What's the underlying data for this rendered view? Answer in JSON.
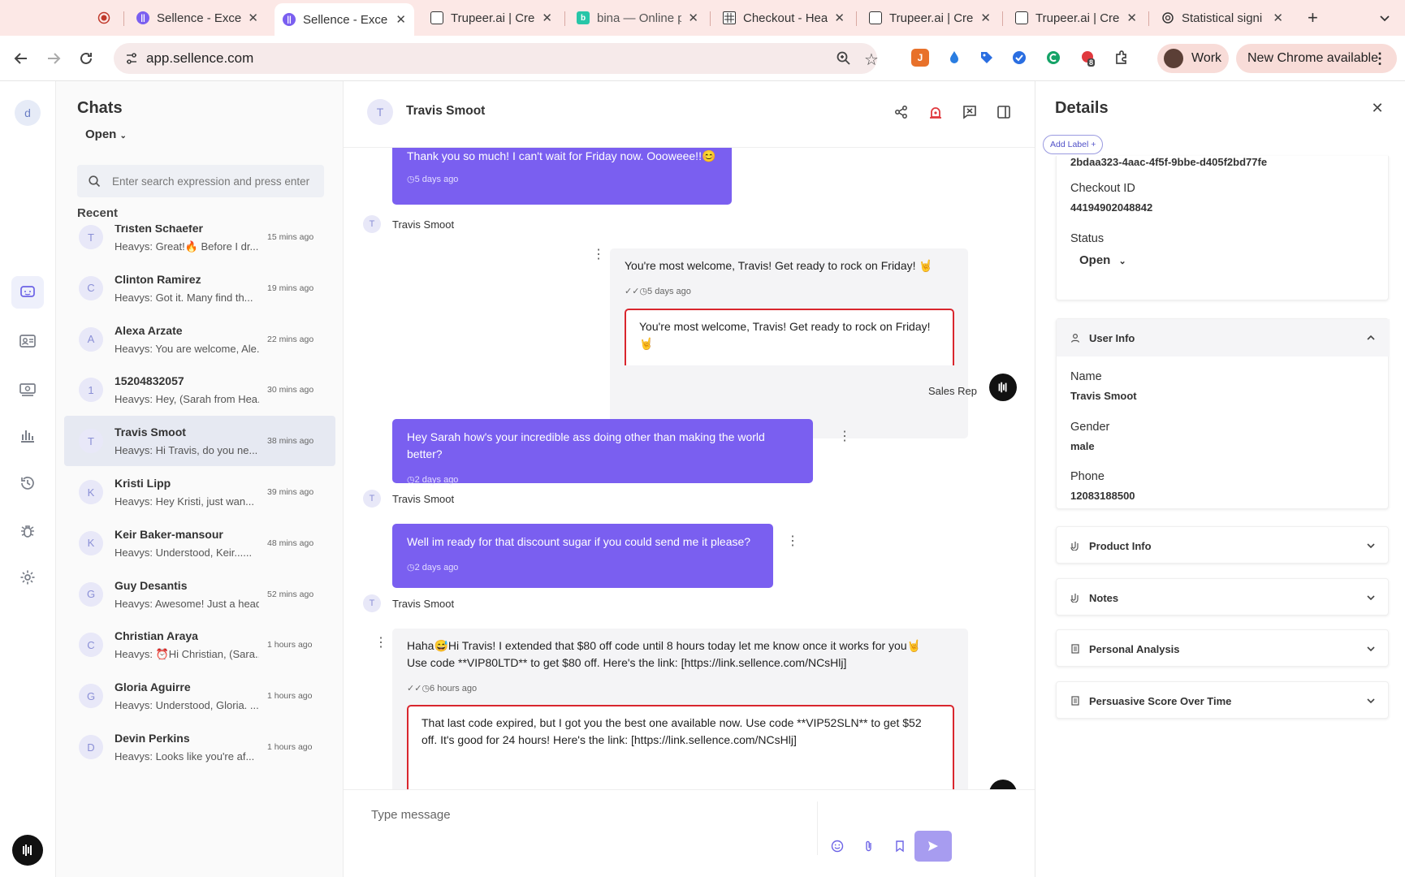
{
  "browser": {
    "tabs": [
      {
        "title": "",
        "icon": "record-icon"
      },
      {
        "title": "Sellence - Exce",
        "icon": "sellence-icon"
      },
      {
        "title": "Sellence - Exce",
        "icon": "sellence-icon",
        "active": true
      },
      {
        "title": "Trupeer.ai | Cre",
        "icon": "trupeer-icon"
      },
      {
        "title": "bina — Online p",
        "icon": "bina-icon"
      },
      {
        "title": "Checkout - Hea",
        "icon": "sheet-icon"
      },
      {
        "title": "Trupeer.ai | Cre",
        "icon": "trupeer-icon"
      },
      {
        "title": "Trupeer.ai | Cre",
        "icon": "trupeer-icon"
      },
      {
        "title": "Statistical signi",
        "icon": "openai-icon"
      }
    ],
    "url": "app.sellence.com",
    "profile": "Work",
    "update_label": "New Chrome available",
    "extension_badge": "8"
  },
  "rail": {
    "workspace_initial": "d"
  },
  "chats": {
    "title": "Chats",
    "filter": "Open",
    "search_placeholder": "Enter search expression and press enter",
    "recent_label": "Recent",
    "items": [
      {
        "initial": "T",
        "name": "Tristen Schaefer",
        "preview": "Heavys: Great!🔥 Before I dr...",
        "time": "15 mins ago"
      },
      {
        "initial": "C",
        "name": "Clinton Ramirez",
        "preview": "Heavys: Got it. Many find th...",
        "time": "19 mins ago"
      },
      {
        "initial": "A",
        "name": "Alexa Arzate",
        "preview": "Heavys: You are welcome, Ale...",
        "time": "22 mins ago"
      },
      {
        "initial": "1",
        "name": "15204832057",
        "preview": "Heavys: Hey, (Sarah from Hea...",
        "time": "30 mins ago"
      },
      {
        "initial": "T",
        "name": "Travis Smoot",
        "preview": "Heavys: Hi Travis, do you ne...",
        "time": "38 mins ago",
        "active": true
      },
      {
        "initial": "K",
        "name": "Kristi Lipp",
        "preview": "Heavys: Hey Kristi, just wan...",
        "time": "39 mins ago"
      },
      {
        "initial": "K",
        "name": "Keir Baker-mansour",
        "preview": "Heavys: Understood, Keir......",
        "time": "48 mins ago"
      },
      {
        "initial": "G",
        "name": "Guy Desantis",
        "preview": "Heavys: Awesome! Just a head...",
        "time": "52 mins ago"
      },
      {
        "initial": "C",
        "name": "Christian Araya",
        "preview": "Heavys: ⏰Hi Christian, (Sara...",
        "time": "1 hours ago"
      },
      {
        "initial": "G",
        "name": "Gloria Aguirre",
        "preview": "Heavys: Understood, Gloria. ...",
        "time": "1 hours ago"
      },
      {
        "initial": "D",
        "name": "Devin Perkins",
        "preview": "Heavys: Looks like you're af...",
        "time": "1 hours ago"
      }
    ]
  },
  "conversation": {
    "contact_initial": "T",
    "contact_name": "Travis Smoot",
    "messages": {
      "m1_text": "Thank you so much! I can't wait for Friday now. Oooweee!!😊",
      "m1_time": "5 days ago",
      "m1_sender": "Travis Smoot",
      "m2_text": "You're most welcome, Travis! Get ready to rock on Friday! 🤘",
      "m2_time": "5 days ago",
      "m2_suggestion": "You're most welcome, Travis! Get ready to rock on Friday! 🤘",
      "m2_sender": "Sales Rep",
      "m3_text": "Hey Sarah how's your incredible ass doing other than making the world better?",
      "m3_time": "2 days ago",
      "m3_sender": "Travis Smoot",
      "m4_text": "Well im ready for that discount sugar if you could send me it please?",
      "m4_time": "2 days ago",
      "m4_sender": "Travis Smoot",
      "m5_line1": "Haha😅Hi Travis! I extended that $80 off code until 8 hours today let me know once it works for you🤘",
      "m5_line2": "Use code **VIP80LTD** to get $80 off. Here's the link: [https://link.sellence.com/NCsHlj]",
      "m5_time": "6 hours ago",
      "m5_suggestion_line1": "That last code expired, but I got you the best one available now. Use code **VIP52SLN** to get $52",
      "m5_suggestion_line2": "off. It's good for 24 hours! Here's the link: [https://link.sellence.com/NCsHlj]"
    },
    "composer_placeholder": "Type message"
  },
  "details": {
    "title": "Details",
    "add_label": "Add Label +",
    "id_value": "2bdaa323-4aac-4f5f-9bbe-d405f2bd77fe",
    "checkout_label": "Checkout ID",
    "checkout_value": "44194902048842",
    "status_label": "Status",
    "status_value": "Open",
    "user_info": {
      "title": "User Info",
      "name_label": "Name",
      "name_value": "Travis Smoot",
      "gender_label": "Gender",
      "gender_value": "male",
      "phone_label": "Phone",
      "phone_value": "12083188500"
    },
    "sections": [
      "Product Info",
      "Notes",
      "Personal Analysis",
      "Persuasive Score Over Time"
    ]
  },
  "colors": {
    "accent": "#7a5ff0",
    "ai_border": "#d9262e",
    "tabbar": "#fce8e6"
  }
}
